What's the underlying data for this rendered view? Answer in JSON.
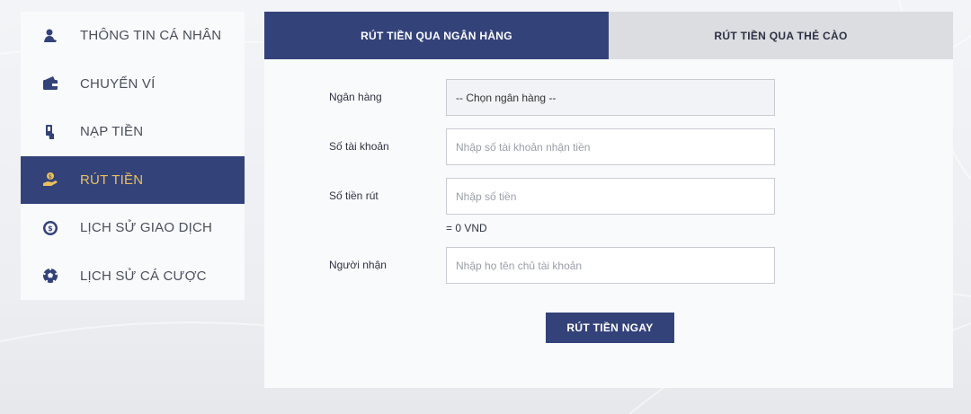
{
  "sidebar": {
    "items": [
      {
        "label": "THÔNG TIN CÁ NHÂN",
        "icon": "user-icon",
        "active": false
      },
      {
        "label": "CHUYỂN VÍ",
        "icon": "wallet-icon",
        "active": false
      },
      {
        "label": "NẠP TIỀN",
        "icon": "deposit-icon",
        "active": false
      },
      {
        "label": "RÚT TIỀN",
        "icon": "withdraw-icon",
        "active": true
      },
      {
        "label": "LỊCH SỬ GIAO DỊCH",
        "icon": "transaction-history-icon",
        "active": false
      },
      {
        "label": "LỊCH SỬ CÁ CƯỢC",
        "icon": "soccer-ball-icon",
        "active": false
      }
    ]
  },
  "tabs": [
    {
      "label": "RÚT TIỀN QUA NGÂN HÀNG",
      "active": true
    },
    {
      "label": "RÚT TIỀN QUA THẺ CÀO",
      "active": false
    }
  ],
  "form": {
    "bank": {
      "label": "Ngân hàng",
      "value": "-- Chọn ngân hàng --"
    },
    "account": {
      "label": "Số tài khoản",
      "placeholder": "Nhập số tài khoản nhận tiền"
    },
    "amount": {
      "label": "Số tiền rút",
      "placeholder": "Nhập số tiền"
    },
    "amount_hint": "= 0 VND",
    "recipient": {
      "label": "Người nhận",
      "placeholder": "Nhập họ tên chủ tài khoản"
    },
    "submit_label": "RÚT TIỀN NGAY"
  },
  "colors": {
    "primary": "#34427a",
    "active_text": "#e9c15b",
    "tab_inactive": "#dcdde1"
  }
}
